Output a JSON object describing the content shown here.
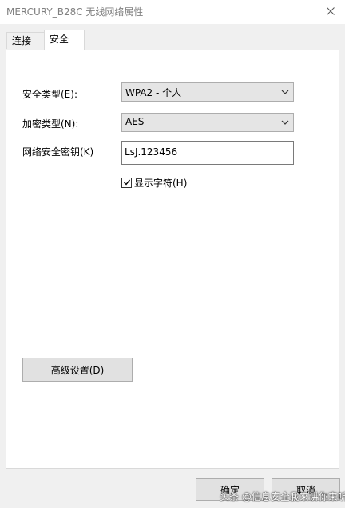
{
  "window": {
    "title": "MERCURY_B28C 无线网络属性",
    "close_icon": "close-icon"
  },
  "tabs": [
    {
      "label": "连接",
      "active": false
    },
    {
      "label": "安全",
      "active": true
    }
  ],
  "security": {
    "security_type_label": "安全类型(E):",
    "security_type_value": "WPA2 - 个人",
    "encryption_type_label": "加密类型(N):",
    "encryption_type_value": "AES",
    "network_key_label": "网络安全密钥(K)",
    "network_key_value": "LsJ.123456",
    "show_characters_label": "显示字符(H)",
    "show_characters_checked": true
  },
  "buttons": {
    "advanced_label": "高级设置(D)",
    "ok_label": "确定",
    "cancel_label": "取消"
  },
  "watermark": {
    "text": "头条 @信息安全我来讲你来听"
  },
  "colors": {
    "window_bg": "#f0f0f0",
    "panel_bg": "#ffffff",
    "combo_bg": "#e5e5e5",
    "button_bg": "#e1e1e1",
    "border": "#adadad"
  }
}
